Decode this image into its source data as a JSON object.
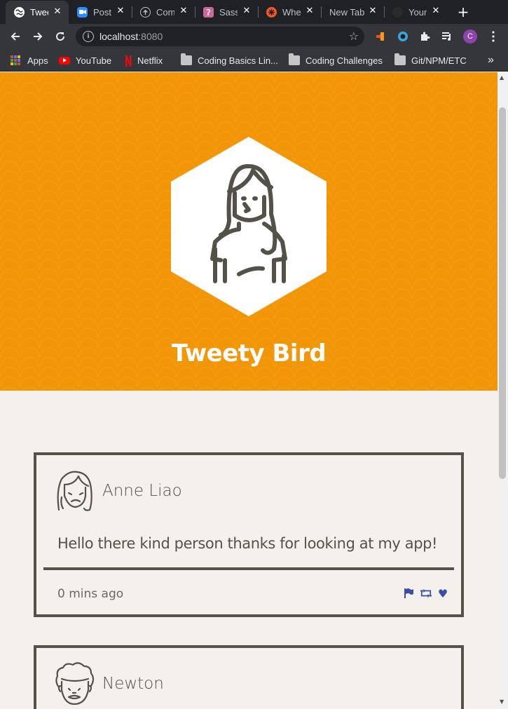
{
  "browser": {
    "tabs": [
      {
        "label": "Twee",
        "active": true,
        "icon": "globe-icon",
        "color": "#ffffff"
      },
      {
        "label": "Post",
        "active": false,
        "icon": "zoom-icon",
        "color": "#2d8cff"
      },
      {
        "label": "Com",
        "active": false,
        "icon": "upload-icon",
        "color": "#202124"
      },
      {
        "label": "Sass",
        "active": false,
        "icon": "sass-icon",
        "color": "#cd6799"
      },
      {
        "label": "Whe",
        "active": false,
        "icon": "asterisk-icon",
        "color": "#f15a24"
      },
      {
        "label": "New Tab",
        "active": false,
        "icon": "none",
        "color": ""
      },
      {
        "label": "Your",
        "active": false,
        "icon": "github-icon",
        "color": "#202124"
      }
    ],
    "url_host": "localhost",
    "url_port": ":8080",
    "profile_initial": "C",
    "bookmarks": [
      {
        "label": "Apps",
        "icon": "apps-grid-icon"
      },
      {
        "label": "YouTube",
        "icon": "youtube-icon"
      },
      {
        "label": "Netflix",
        "icon": "netflix-icon"
      },
      {
        "label": "Coding Basics Lin...",
        "icon": "folder-icon"
      },
      {
        "label": "Coding Challenges",
        "icon": "folder-icon"
      },
      {
        "label": "Git/NPM/ETC",
        "icon": "folder-icon"
      }
    ],
    "more_bookmarks": "»"
  },
  "profile": {
    "name": "Tweety Bird",
    "hero_color": "#f29608"
  },
  "tweets": [
    {
      "author": "Anne Liao",
      "text": "Hello there kind person thanks for looking at my app!",
      "time": "0 mins ago",
      "actions": [
        "flag-icon",
        "retweet-icon",
        "heart-icon"
      ]
    },
    {
      "author": "Newton",
      "text": "",
      "time": "",
      "actions": []
    }
  ],
  "colors": {
    "ink": "#545149",
    "action": "#3b4ea1",
    "background": "#f4f1ec"
  }
}
